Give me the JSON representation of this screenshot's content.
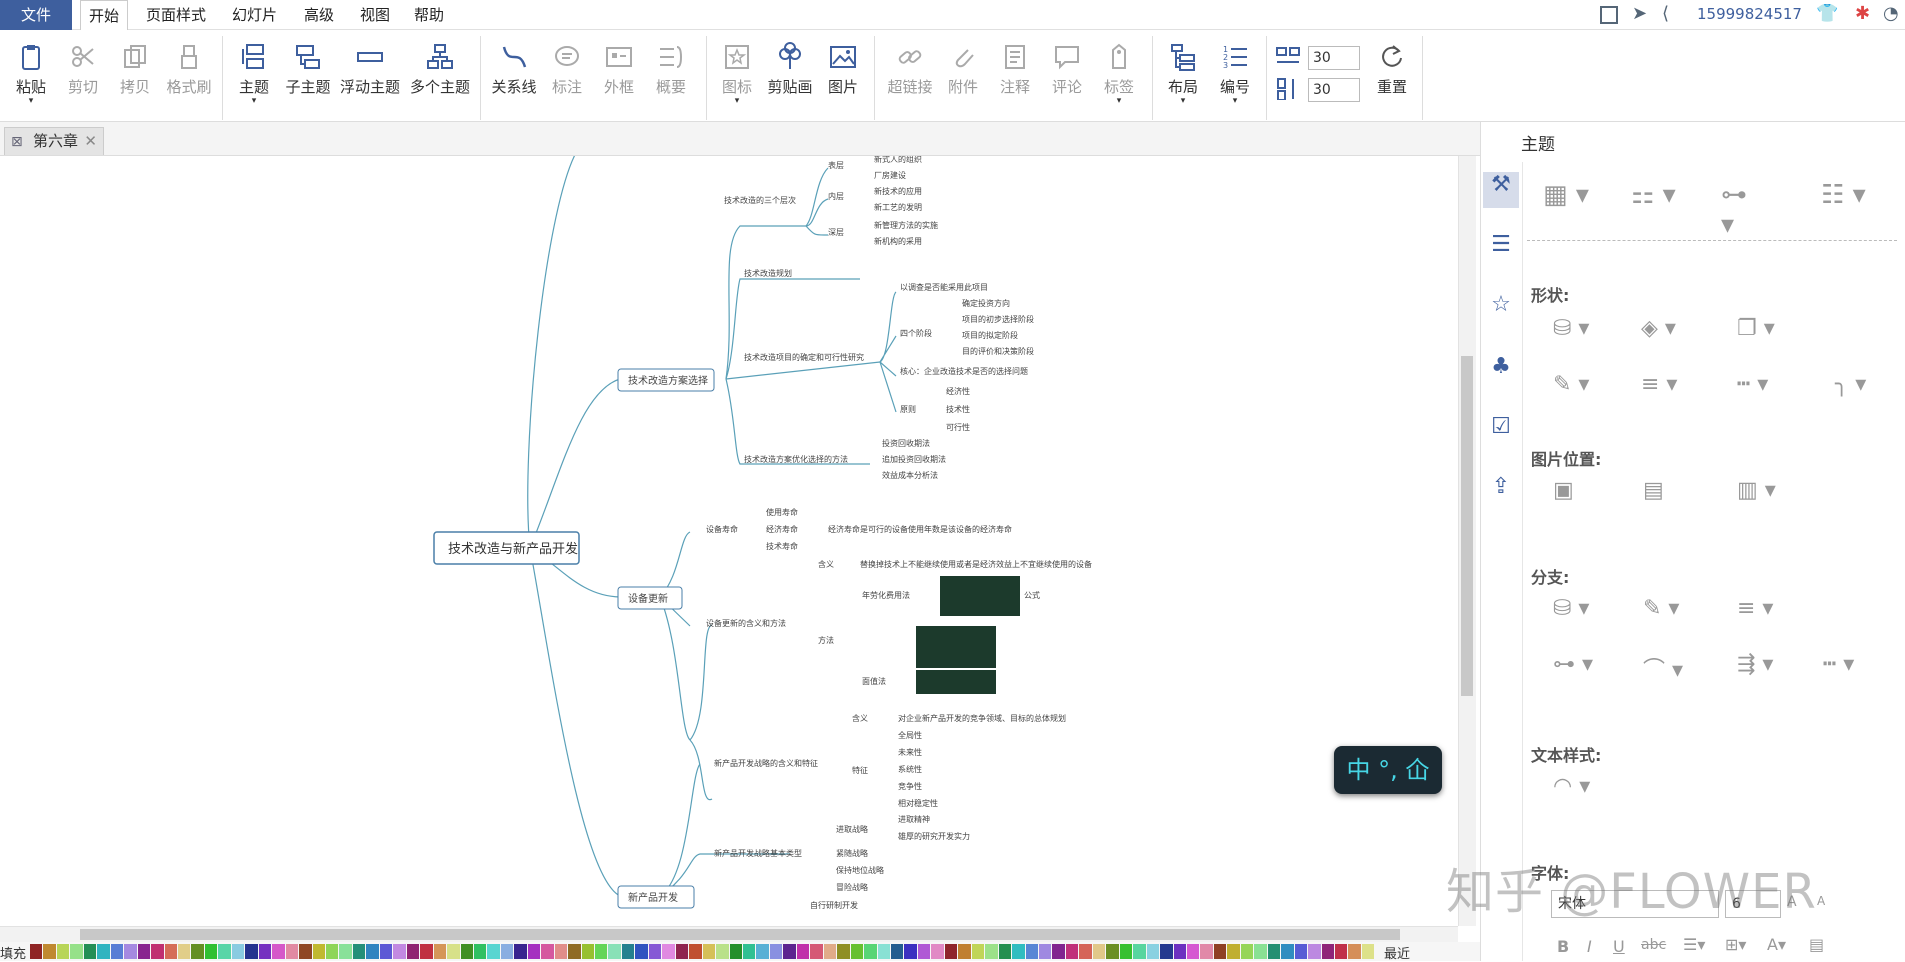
{
  "menu": {
    "file": "文件",
    "items": [
      "开始",
      "页面样式",
      "幻灯片",
      "高级",
      "视图",
      "帮助"
    ],
    "account": "15999824517"
  },
  "toolbar": {
    "paste": "粘贴",
    "cut": "剪切",
    "copy": "拷贝",
    "format_brush": "格式刷",
    "topic": "主题",
    "subtopic": "子主题",
    "float_topic": "浮动主题",
    "multi_topic": "多个主题",
    "relation": "关系线",
    "callout": "标注",
    "boundary": "外框",
    "summary": "概要",
    "icon": "图标",
    "clipart": "剪贴画",
    "picture": "图片",
    "hyperlink": "超链接",
    "attachment": "附件",
    "note": "注释",
    "comment": "评论",
    "label": "标签",
    "layout": "布局",
    "numbering": "编号",
    "spacing_h": "30",
    "spacing_v": "30",
    "reset": "重置"
  },
  "tab": {
    "name": "第六章"
  },
  "panel": {
    "title": "主题",
    "shape": "形状:",
    "image_position": "图片位置:",
    "branch": "分支:",
    "text_style": "文本样式:",
    "font_label": "字体:",
    "font_name": "宋体",
    "font_size": "6"
  },
  "mindmap": {
    "root": "技术改造与新产品开发",
    "branches": {
      "b1": "技术改造方案选择",
      "b2": "设备更新",
      "b3": "新产品开发",
      "top1": "技术改造的三个层次",
      "top1a": "表层",
      "top1b": "内层",
      "top1c": "深层",
      "top1a1": "新式人的组织",
      "top1a2": "厂房建设",
      "top1b1": "新技术的应用",
      "top1b2": "新工艺的发明",
      "top1c1": "新管理方法的实施",
      "top1c2": "新机构的采用",
      "c1": "技术改造规划",
      "c2": "技术改造项目的确定和可行性研究",
      "c3": "技术改造方案优化选择的方法",
      "c2a": "以调查是否能采用此项目",
      "c2b": "四个阶段",
      "c2b1": "确定投资方向",
      "c2b2": "项目的初步选择阶段",
      "c2b3": "项目的拟定阶段",
      "c2b4": "目的评价和决策阶段",
      "c2c": "核心：企业改造技术是否的选择问题",
      "c2d": "原则",
      "c2d1": "经济性",
      "c2d2": "技术性",
      "c2d3": "可行性",
      "c3a": "投资回收期法",
      "c3b": "追加投资回收期法",
      "c3c": "效益成本分析法",
      "d1": "设备寿命",
      "d1a": "使用寿命",
      "d1b": "经济寿命",
      "d1c": "技术寿命",
      "d1b1": "经济寿命是可行的设备使用年数是该设备的经济寿命",
      "d2": "设备更新的含义和方法",
      "d2a": "含义",
      "d2a1": "替换掉技术上不能继续使用或者是经济效益上不宜继续使用的设备",
      "d2b": "方法",
      "d2b1": "年劳化费用法",
      "d2b2": "面值法",
      "d2b1x": "公式",
      "e1": "新产品开发战略的含义和特征",
      "e1a": "含义",
      "e1a1": "对企业新产品开发的竞争领域、目标的总体规划",
      "e1b": "特征",
      "e1b1": "全局性",
      "e1b2": "未来性",
      "e1b3": "系统性",
      "e1b4": "竞争性",
      "e1b5": "相对稳定性",
      "e2": "新产品开发战略基本类型",
      "e2a": "进取战略",
      "e2a1": "进取精神",
      "e2a2": "雄厚的研究开发实力",
      "e2b": "紧随战略",
      "e2c": "保持地位战略",
      "e2d": "冒险战略",
      "e3": "自行研制开发"
    }
  },
  "ime": "中 °, 仚",
  "watermark": "知乎 @FLOWER",
  "colors": {
    "accent": "#3e5f9e",
    "branch_line": "#5aa0b8",
    "node_border": "#4a7fa8"
  },
  "palette": {
    "left": "填充",
    "recent": "最近"
  }
}
